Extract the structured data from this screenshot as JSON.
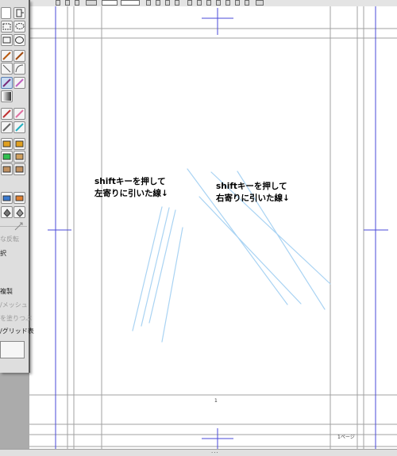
{
  "palette": {
    "labels": {
      "reverse": "な反転",
      "select": "択",
      "copy": "複製",
      "mesh": "/メッシュ",
      "fill": "を塗りつぶ",
      "grid": "/グリッド表"
    }
  },
  "canvas": {
    "annotation_left": [
      "shiftキーを押して",
      "左寄りに引いた線↓"
    ],
    "annotation_right": [
      "shiftキーを押して",
      "右寄りに引いた線↓"
    ],
    "page_number": "1",
    "page_label": "1ページ"
  },
  "colors": {
    "stroke": "#a9d3f3",
    "guide_blue": "#4a4ad8",
    "frame_gray": "#9a9a9a"
  }
}
